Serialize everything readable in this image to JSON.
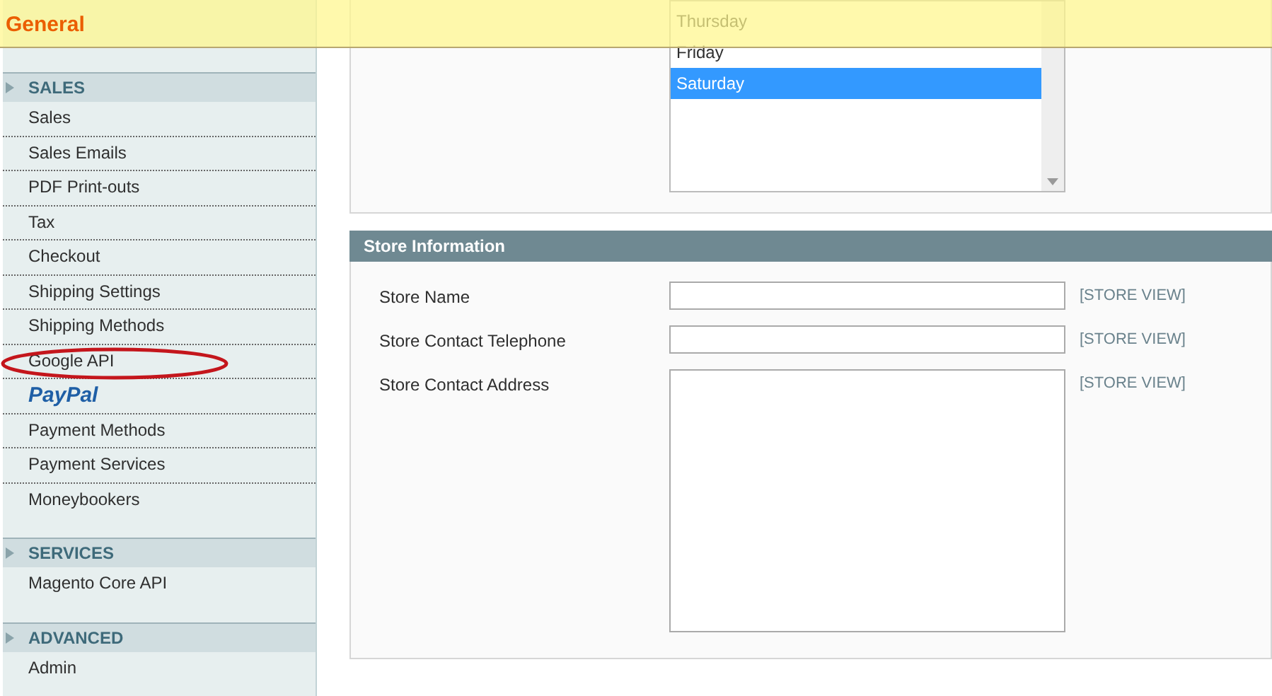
{
  "banner": {
    "title": "General"
  },
  "sidebar": {
    "sections": [
      {
        "title": "SALES",
        "items": [
          {
            "label": "Sales",
            "kind": "text",
            "circled": false
          },
          {
            "label": "Sales Emails",
            "kind": "text",
            "circled": false
          },
          {
            "label": "PDF Print-outs",
            "kind": "text",
            "circled": false
          },
          {
            "label": "Tax",
            "kind": "text",
            "circled": false
          },
          {
            "label": "Checkout",
            "kind": "text",
            "circled": false
          },
          {
            "label": "Shipping Settings",
            "kind": "text",
            "circled": false
          },
          {
            "label": "Shipping Methods",
            "kind": "text",
            "circled": false
          },
          {
            "label": "Google API",
            "kind": "text",
            "circled": true
          },
          {
            "label": "PayPal",
            "kind": "logo",
            "circled": false
          },
          {
            "label": "Payment Methods",
            "kind": "text",
            "circled": false
          },
          {
            "label": "Payment Services",
            "kind": "text",
            "circled": false
          },
          {
            "label": "Moneybookers",
            "kind": "text",
            "circled": false
          }
        ]
      },
      {
        "title": "SERVICES",
        "items": [
          {
            "label": "Magento Core API",
            "kind": "text",
            "circled": false
          }
        ]
      },
      {
        "title": "ADVANCED",
        "items": [
          {
            "label": "Admin",
            "kind": "text",
            "circled": false
          }
        ]
      }
    ]
  },
  "days_list": {
    "options": [
      {
        "label": "Thursday",
        "selected": false
      },
      {
        "label": "Friday",
        "selected": false
      },
      {
        "label": "Saturday",
        "selected": true
      }
    ]
  },
  "store_information": {
    "title": "Store Information",
    "fields": [
      {
        "label": "Store Name",
        "kind": "input",
        "scope": "[STORE VIEW]"
      },
      {
        "label": "Store Contact Telephone",
        "kind": "input",
        "scope": "[STORE VIEW]"
      },
      {
        "label": "Store Contact Address",
        "kind": "textarea",
        "scope": "[STORE VIEW]"
      }
    ]
  }
}
